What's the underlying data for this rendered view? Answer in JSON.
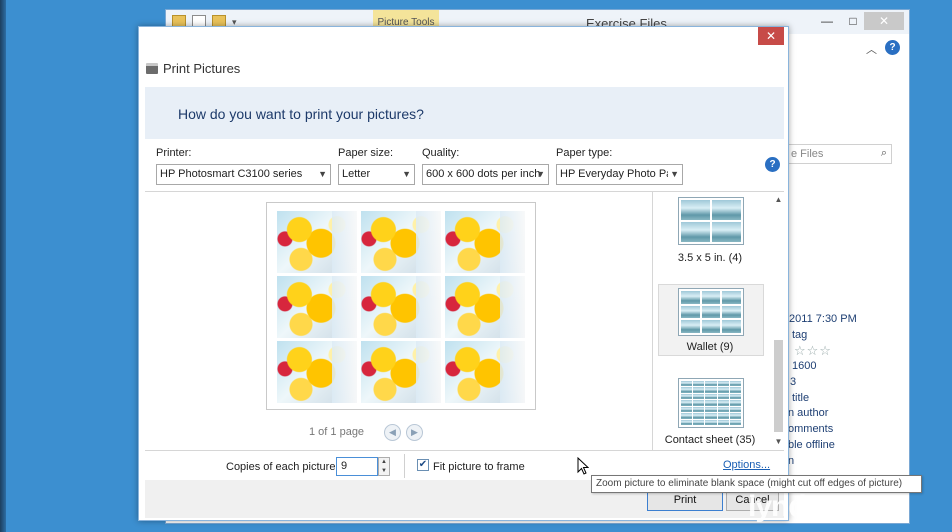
{
  "explorer": {
    "title": "Exercise Files",
    "contextual_tab": "Picture Tools",
    "minimize": "—",
    "maximize": "□",
    "close": "✕",
    "help": "?",
    "search_placeholder": "e Files",
    "details": {
      "date": "/2011 7:30 PM",
      "tag": "tag",
      "stars": "☆☆☆",
      "dimension": "1600",
      "count": "3",
      "title": "title",
      "author": "n author",
      "comments": "omments",
      "offline": "ble offline",
      "last": "n"
    }
  },
  "dialog": {
    "title": "Print Pictures",
    "close": "✕",
    "question": "How do you want to print your pictures?",
    "printer": {
      "label": "Printer:",
      "value": "HP Photosmart C3100 series"
    },
    "paper_size": {
      "label": "Paper size:",
      "value": "Letter"
    },
    "quality": {
      "label": "Quality:",
      "value": "600 x 600 dots per inch"
    },
    "paper_type": {
      "label": "Paper type:",
      "value": "HP Everyday Photo Pap"
    },
    "help": "?",
    "preview": {
      "page_indicator": "1 of 1 page",
      "prev": "◀",
      "next": "▶"
    },
    "layouts": [
      {
        "label": "3.5 x 5 in. (4)",
        "selected": false
      },
      {
        "label": "Wallet (9)",
        "selected": true
      },
      {
        "label": "Contact sheet (35)",
        "selected": false
      }
    ],
    "copies": {
      "label": "Copies of each picture:",
      "value": "9"
    },
    "fit": {
      "label": "Fit picture to frame",
      "checked": true,
      "mark": "✔"
    },
    "options_link": "Options...",
    "print_button": "Print",
    "cancel_button": "Cancel",
    "tooltip": "Zoom picture to eliminate blank space (might cut off edges of picture)"
  },
  "watermark": "lynda.com",
  "colors": {
    "desktop": "#3c8fd0",
    "banner": "#e8eff7",
    "close_red": "#c74b48",
    "link": "#1a5fb4"
  }
}
